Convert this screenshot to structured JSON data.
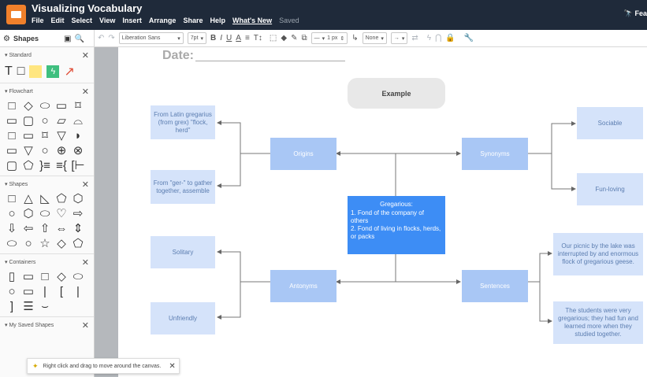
{
  "app": {
    "doc_title": "Visualizing Vocabulary",
    "menu": [
      "File",
      "Edit",
      "Select",
      "View",
      "Insert",
      "Arrange",
      "Share",
      "Help"
    ],
    "whats_new": "What's New",
    "saved": "Saved",
    "feature_link": "Fea"
  },
  "toolbar": {
    "shapes_label": "Shapes",
    "font_family": "Liberation Sans",
    "font_size": "7pt",
    "bold": "B",
    "italic": "I",
    "underline": "U",
    "font_color": "A",
    "align": "≡",
    "text_size": "T↕",
    "line_width": "1 px",
    "arrow_none": "None"
  },
  "sidebar": {
    "sections": [
      {
        "title": "Standard"
      },
      {
        "title": "Flowchart"
      },
      {
        "title": "Shapes"
      },
      {
        "title": "Containers"
      },
      {
        "title": "My Saved Shapes"
      }
    ],
    "standard_glyphs": [
      "T",
      "□",
      "",
      "",
      "↗"
    ],
    "flowchart_glyphs": [
      "□",
      "◇",
      "⬭",
      "▭",
      "⌑",
      "▭",
      "▢",
      "○",
      "▱",
      "⌓",
      "□",
      "▭",
      "⌑",
      "▽",
      "◗",
      "▭",
      "▽",
      "○",
      "⊕",
      "⊗",
      "▢",
      "⬠",
      "}≡",
      "≡{",
      "[⊢"
    ],
    "shapes_glyphs": [
      "□",
      "△",
      "◺",
      "⬠",
      "⬡",
      "○",
      "⬡",
      "⬭",
      "♡",
      "⇨",
      "⇩",
      "⇦",
      "⇧",
      "⇔",
      "⇕",
      "⬭",
      "○",
      "☆",
      "◇",
      "⬠"
    ],
    "container_glyphs": [
      "▯",
      "▭",
      "□",
      "◇",
      "⬭",
      "○",
      "▭",
      "|",
      "[",
      "|",
      "]",
      "☰",
      "⌣"
    ]
  },
  "canvas": {
    "date_label": "Date:"
  },
  "diagram": {
    "example": "Example",
    "center_title": "Gregarious:",
    "center_lines": [
      "1. Fond of the company of others",
      "2. Fond of living in flocks, herds, or packs"
    ],
    "origins": "Origins",
    "synonyms": "Synonyms",
    "antonyms": "Antonyms",
    "sentences": "Sentences",
    "origin_1": "From Latin gregarius (from grex) \"flock, herd\"",
    "origin_2": "From \"ger-\" to gather together, assemble",
    "synonym_1": "Sociable",
    "synonym_2": "Fun-loving",
    "antonym_1": "Solitary",
    "antonym_2": "Unfriendly",
    "sentence_1": "Our picnic by the lake was interrupted by and enormous flock of gregarious geese.",
    "sentence_2": "The students were very gregarious; they had fun and learned more when they studied together."
  },
  "tooltip": {
    "text": "Right click and drag to move around the canvas.",
    "close": "✕"
  },
  "colors": {
    "node_light": "#d5e3fa",
    "node_mid": "#a9c7f5",
    "node_center": "#3d8df5",
    "titlebar": "#1f2a3a",
    "logo": "#f0802b"
  }
}
